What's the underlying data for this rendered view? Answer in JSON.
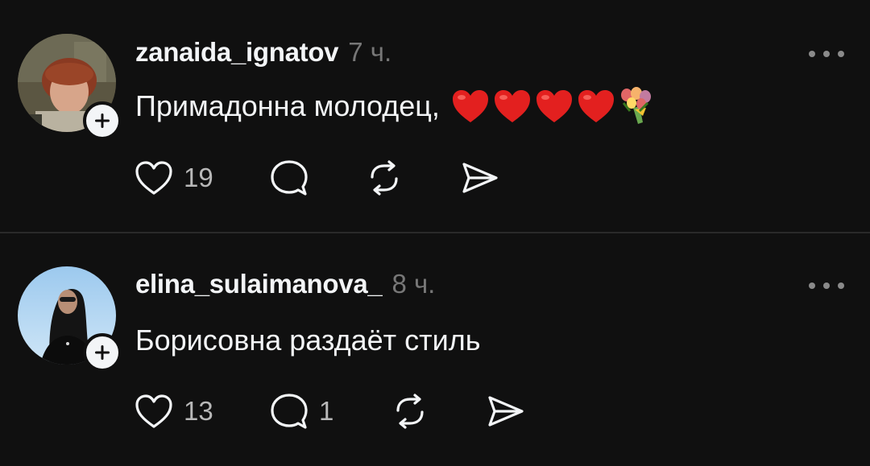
{
  "posts": [
    {
      "username": "zanaida_ignatov",
      "time": "7 ч.",
      "text": "Примадонна молодец,",
      "emojis": [
        "heart-emoji",
        "heart-emoji",
        "heart-emoji",
        "heart-emoji",
        "bouquet-emoji"
      ],
      "likes": "19",
      "replies": "",
      "avatar_icon": "user-photo-avatar"
    },
    {
      "username": "elina_sulaimanova_",
      "time": "8 ч.",
      "text": "Борисовна раздаёт стиль",
      "emojis": [],
      "likes": "13",
      "replies": "1",
      "avatar_icon": "user-photo-avatar"
    }
  ],
  "colors": {
    "background": "#101010",
    "text": "#f3f5f7",
    "secondary": "#777777",
    "divider": "#2a2a2a"
  },
  "icons": {
    "like": "heart-outline-icon",
    "reply": "comment-bubble-icon",
    "repost": "repost-arrows-icon",
    "share": "send-arrow-icon",
    "more": "more-dots-icon",
    "follow": "plus-icon"
  }
}
